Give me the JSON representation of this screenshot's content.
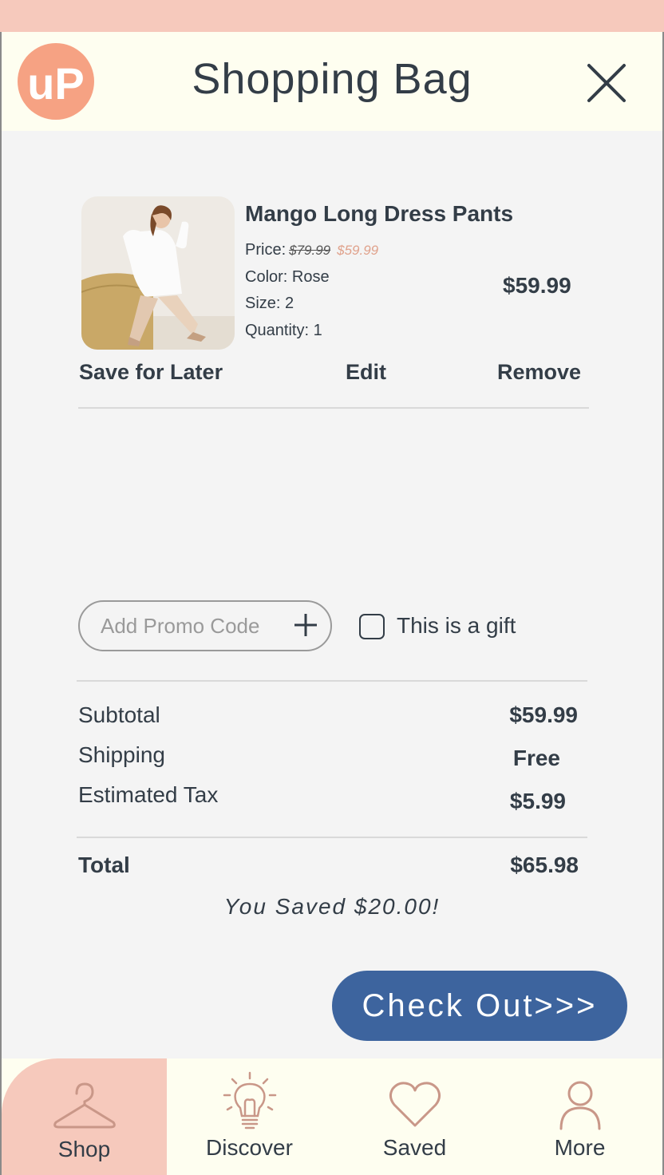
{
  "header": {
    "title": "Shopping Bag",
    "logo_icon": "up-logo",
    "close_icon": "close-icon"
  },
  "item": {
    "name": "Mango Long Dress Pants",
    "price_label": "Price:",
    "original_price": "$79.99",
    "sale_price": "$59.99",
    "color": "Color: Rose",
    "size": "Size: 2",
    "quantity": "Quantity: 1",
    "line_total": "$59.99",
    "image_icon": "product-photo"
  },
  "actions": {
    "save_later": "Save for Later",
    "edit": "Edit",
    "remove": "Remove"
  },
  "promo": {
    "placeholder": "Add Promo Code",
    "icon": "plus-icon"
  },
  "gift": {
    "label": "This is a gift",
    "checked": false
  },
  "summary": {
    "subtotal_label": "Subtotal",
    "subtotal": "$59.99",
    "shipping_label": "Shipping",
    "shipping": "Free",
    "tax_label": "Estimated Tax",
    "tax": "$5.99",
    "total_label": "Total",
    "total": "$65.98",
    "saved": "You Saved $20.00!"
  },
  "checkout": {
    "label": "Check Out>>>"
  },
  "nav": [
    {
      "label": "Shop",
      "icon": "hanger-icon",
      "active": true
    },
    {
      "label": "Discover",
      "icon": "lightbulb-icon",
      "active": false
    },
    {
      "label": "Saved",
      "icon": "heart-icon",
      "active": false
    },
    {
      "label": "More",
      "icon": "user-icon",
      "active": false
    }
  ],
  "colors": {
    "accent_peach": "#f6c9bc",
    "logo": "#f6a283",
    "checkout_blue": "#3d649e",
    "text": "#333d47",
    "header_bg": "#fefef0",
    "sale_text": "#e0a28c"
  }
}
